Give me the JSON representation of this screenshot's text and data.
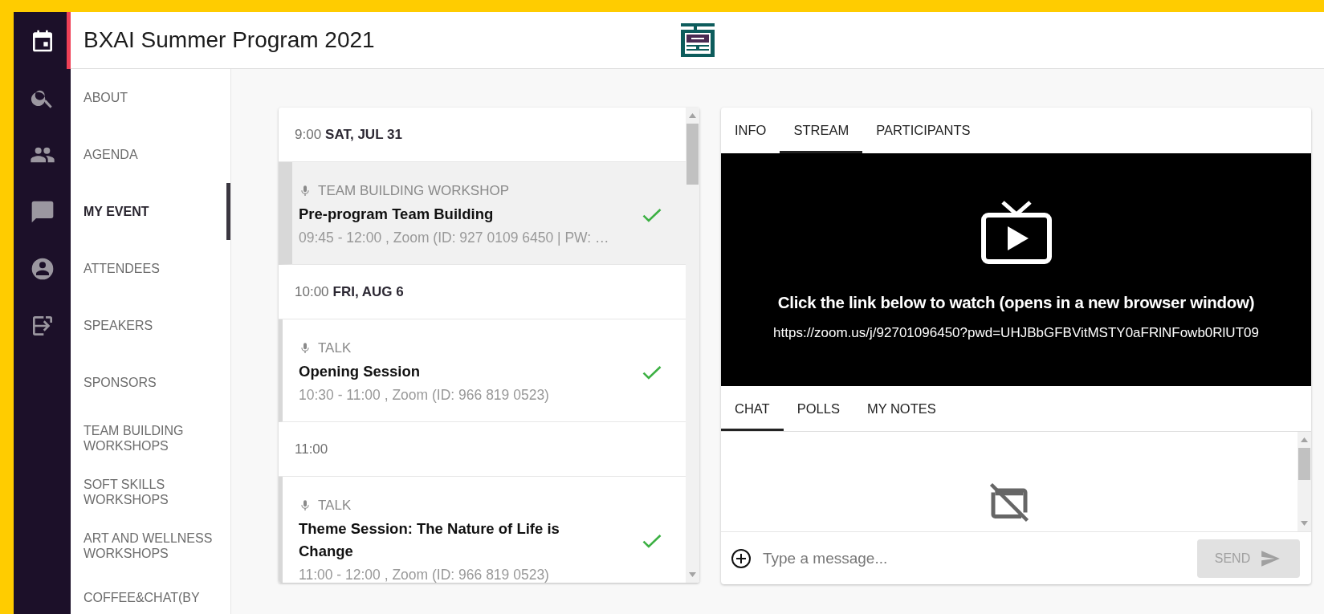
{
  "rail": [
    {
      "kind": "calendar",
      "selected": true
    },
    {
      "kind": "search",
      "selected": false
    },
    {
      "kind": "people",
      "selected": false
    },
    {
      "kind": "chat",
      "selected": false
    },
    {
      "kind": "account",
      "selected": false
    },
    {
      "kind": "login",
      "selected": false
    }
  ],
  "header": {
    "title": "BXAI Summer Program 2021"
  },
  "nav": [
    {
      "label": "ABOUT",
      "selected": false
    },
    {
      "label": "AGENDA",
      "selected": false
    },
    {
      "label": "MY EVENT",
      "selected": true
    },
    {
      "label": "ATTENDEES",
      "selected": false
    },
    {
      "label": "SPEAKERS",
      "selected": false
    },
    {
      "label": "SPONSORS",
      "selected": false
    },
    {
      "label": "TEAM BUILDING WORKSHOPS",
      "selected": false
    },
    {
      "label": "SOFT SKILLS WORKSHOPS",
      "selected": false
    },
    {
      "label": "ART AND WELLNESS WORKSHOPS",
      "selected": false
    },
    {
      "label": "COFFEE&CHAT(BY",
      "selected": false
    }
  ],
  "agenda": [
    {
      "kind": "heading",
      "time": "9:00",
      "date": "SAT, JUL 31"
    },
    {
      "kind": "event",
      "category": "TEAM BUILDING WORKSHOP",
      "title": "Pre-program Team Building",
      "details": "09:45 - 12:00 , Zoom (ID: 927 0109 6450 | PW: …",
      "checked": true,
      "selected": true
    },
    {
      "kind": "heading",
      "time": "10:00",
      "date": "FRI, AUG 6"
    },
    {
      "kind": "event",
      "category": "TALK",
      "title": "Opening Session",
      "details": "10:30 - 11:00 , Zoom (ID: 966 819 0523)",
      "checked": true,
      "selected": false
    },
    {
      "kind": "heading",
      "time": "11:00"
    },
    {
      "kind": "event",
      "category": "TALK",
      "title": "Theme Session: The Nature of Life is Change",
      "details": "11:00 - 12:00 , Zoom (ID: 966 819 0523)",
      "checked": true,
      "selected": false
    }
  ],
  "detail_tabs": [
    {
      "label": "INFO",
      "selected": false
    },
    {
      "label": "STREAM",
      "selected": true
    },
    {
      "label": "PARTICIPANTS",
      "selected": false
    }
  ],
  "stream": {
    "message": "Click the link below to watch (opens in a new browser window)",
    "link": "https://zoom.us/j/92701096450?pwd=UHJBbGFBVitMSTY0aFRlNFowb0RlUT09"
  },
  "chat_tabs": [
    {
      "label": "CHAT",
      "selected": true
    },
    {
      "label": "POLLS",
      "selected": false
    },
    {
      "label": "MY NOTES",
      "selected": false
    }
  ],
  "composer": {
    "placeholder": "Type a message...",
    "send": "SEND",
    "send_disabled": true
  }
}
